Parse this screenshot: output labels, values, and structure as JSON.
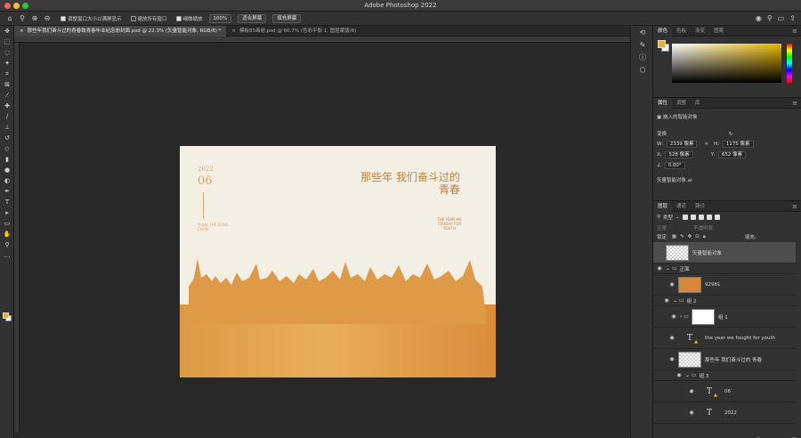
{
  "window": {
    "title": "Adobe Photoshop 2022"
  },
  "options": {
    "check1": "调整窗口大小以满屏显示",
    "check2": "缩放所有窗口",
    "check3": "细微缩放",
    "zoom": "100%",
    "btn_fit": "适合屏幕",
    "btn_fill": "填充屏幕"
  },
  "tabs": [
    {
      "label": "那些年我们奋斗过的青春致青春毕业纪念册封面.psd @ 22.3% (矢量智能对象, RGB/8) *"
    },
    {
      "label": "模板85画册.psd @ 66.7% (色彩平衡 1, 图层蒙版/8)"
    }
  ],
  "artwork": {
    "year": "2022",
    "month": "06",
    "sub_text": "毕业啦 THE DONG CHUN",
    "headline": "那些年 我们奋斗过的 青春",
    "english": "THE YEAR WE FOUGHT FOR YOUTH"
  },
  "color_panel": {
    "tabs": [
      "颜色",
      "色板",
      "渐变",
      "图案"
    ]
  },
  "properties": {
    "tabs": [
      "属性",
      "调整",
      "库"
    ],
    "object_type": "嵌入的智能对象",
    "transform_label": "变换",
    "w": "2339 像素",
    "h": "1175 像素",
    "x": "528 像素",
    "y": "652 像素",
    "angle": "0.00°",
    "file": "矢量智能对象.ai"
  },
  "layers": {
    "tabs": [
      "图层",
      "通道",
      "路径"
    ],
    "filter": "类型",
    "blend": "正常",
    "opacity_label": "不透明度:",
    "lock_label": "锁定:",
    "fill_label": "填充:",
    "items": [
      {
        "name": "矢量智能对象",
        "kind": "smart",
        "selected": true
      },
      {
        "name": "正面",
        "kind": "folder"
      },
      {
        "name": "92981",
        "kind": "image"
      },
      {
        "name": "组 2",
        "kind": "folder"
      },
      {
        "name": "组 1",
        "kind": "group-white"
      },
      {
        "name": "the year we fought for youth",
        "kind": "text"
      },
      {
        "name": "那些年 我们奋斗过的 青春",
        "kind": "smart"
      },
      {
        "name": "组 3",
        "kind": "folder"
      },
      {
        "name": "06",
        "kind": "text"
      },
      {
        "name": "2022",
        "kind": "text"
      }
    ]
  }
}
